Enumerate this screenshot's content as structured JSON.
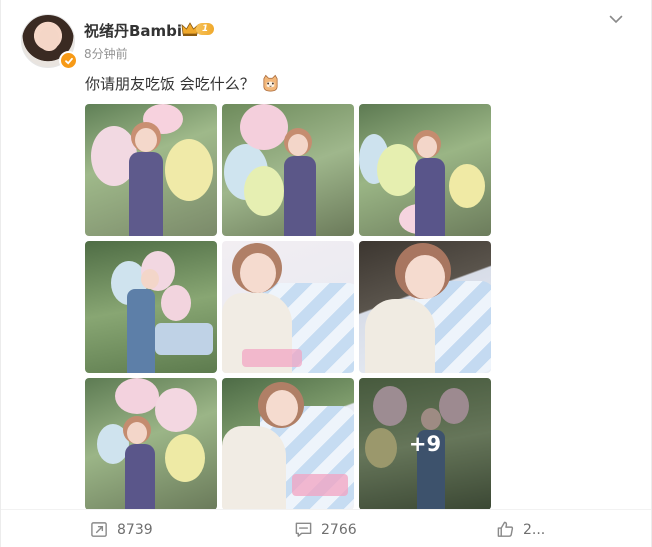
{
  "post": {
    "username": "祝绪丹Bambi",
    "member_level": "1",
    "time": "8分钟前",
    "text": "你请朋友吃饭 会吃什么？",
    "emoji": "cat-face-emoji",
    "more_photos_label": "+9",
    "icons": {
      "avatar": "user-avatar",
      "verified": "verified-badge-icon",
      "crown": "crown-icon",
      "more": "chevron-down-icon",
      "repost": "repost-icon",
      "comment": "comment-icon",
      "like": "like-icon"
    }
  },
  "stats": {
    "reposts": "8739",
    "comments": "2766",
    "likes": "2..."
  },
  "colors": {
    "accent": "#f79a17",
    "text": "#333333",
    "muted": "#939393"
  }
}
